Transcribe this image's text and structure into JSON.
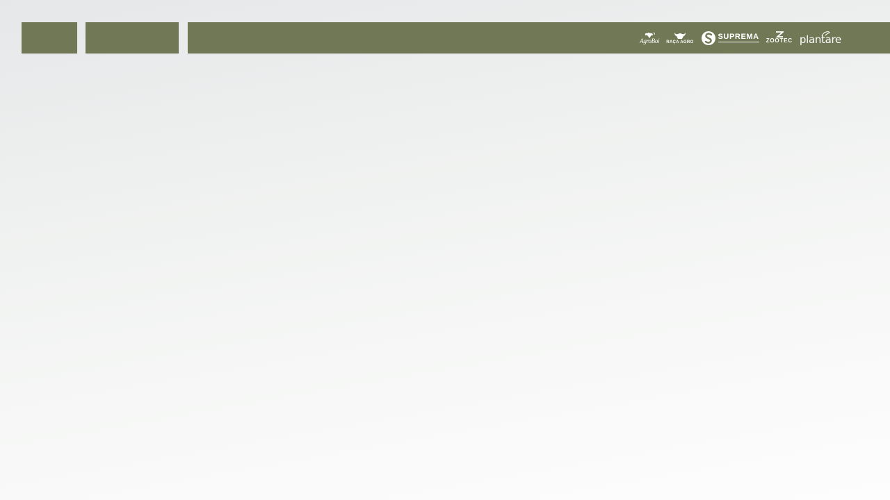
{
  "nav": {
    "button_a_label": "",
    "button_b_label": ""
  },
  "banner": {
    "color": "#717856",
    "sponsors": [
      {
        "name": "AgroBoi",
        "sub": "",
        "icon": "agroboi-logo-icon"
      },
      {
        "name": "RAÇA AGRO",
        "icon": "raca-agro-logo-icon"
      },
      {
        "name": "SUPREMA",
        "sub": "",
        "icon": "suprema-logo-icon"
      },
      {
        "name": "ZOOTEC",
        "sub": "",
        "icon": "zootec-logo-icon"
      },
      {
        "name": "plantare",
        "icon": "plantare-logo-icon"
      }
    ]
  },
  "colors": {
    "bar": "#717856",
    "background_top": "#e6e7e9",
    "background_bottom": "#fdfdfd",
    "logo": "#ffffff"
  }
}
